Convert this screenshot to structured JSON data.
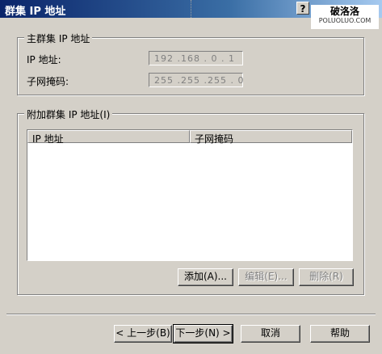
{
  "window": {
    "title": "群集 IP 地址",
    "help_glyph": "?"
  },
  "watermark": {
    "main": "破洛洛",
    "sub": "POLUOLUO.COM"
  },
  "primary_group": {
    "legend": "主群集 IP 地址",
    "ip_label": "IP 地址:",
    "ip_value": "192 .168 . 0 . 1",
    "mask_label": "子网掩码:",
    "mask_value": "255 .255 .255 . 0"
  },
  "additional_group": {
    "legend": "附加群集 IP 地址(I)",
    "columns": [
      "IP 地址",
      "子网掩码"
    ],
    "rows": [],
    "add_label": "添加(A)...",
    "edit_label": "编辑(E)...",
    "delete_label": "删除(R)"
  },
  "footer": {
    "back_label": "< 上一步(B)",
    "next_label": "下一步(N) >",
    "cancel_label": "取消",
    "help_label": "帮助"
  }
}
